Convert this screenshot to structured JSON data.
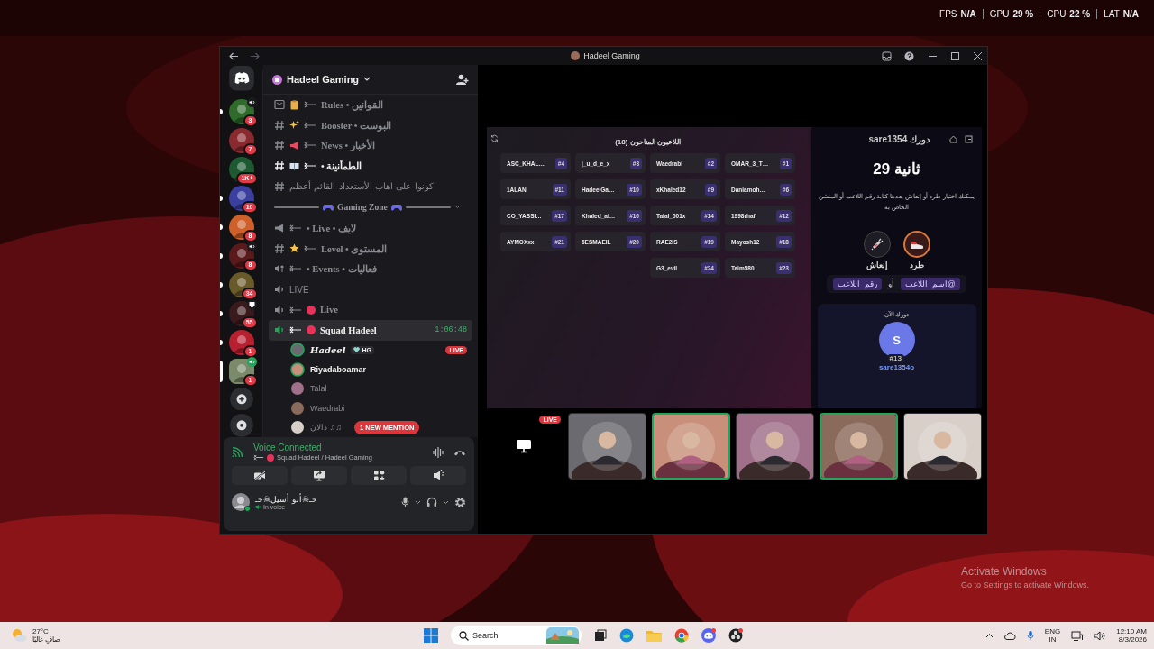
{
  "overlay": [
    {
      "label": "FPS",
      "value": "N/A"
    },
    {
      "label": "GPU",
      "value": "29 %"
    },
    {
      "label": "CPU",
      "value": "22 %"
    },
    {
      "label": "LAT",
      "value": "N/A"
    }
  ],
  "window": {
    "title": "Hadeel Gaming"
  },
  "servers": [
    {
      "badge": "3",
      "unread": true,
      "selected": false
    },
    {
      "badge": "7",
      "unread": false,
      "selected": false
    },
    {
      "badge": "1K+",
      "unread": false,
      "selected": false
    },
    {
      "badge": "10",
      "unread": true,
      "selected": false
    },
    {
      "badge": "8",
      "unread": true,
      "selected": false
    },
    {
      "badge": "8",
      "unread": true,
      "selected": false
    },
    {
      "badge": "34",
      "unread": true,
      "selected": false
    },
    {
      "badge": "55",
      "unread": true,
      "selected": false
    },
    {
      "badge": "1",
      "unread": true,
      "selected": false
    },
    {
      "badge": "1",
      "unread": false,
      "selected": true
    }
  ],
  "server_header": {
    "name": "Hadeel Gaming"
  },
  "channels": [
    {
      "kind": "rules",
      "name": "Rules • القوانين",
      "unread": false,
      "selected": false
    },
    {
      "kind": "text",
      "name": "Booster • البوست",
      "unread": false,
      "selected": false
    },
    {
      "kind": "text",
      "name": "News • الأخبار",
      "unread": false,
      "selected": false
    },
    {
      "kind": "text",
      "name": "• الطمأنينة",
      "unread": true,
      "selected": false
    },
    {
      "kind": "text",
      "name": "كونوا-على-اهاب-الأستعداد-القائم-أعظم",
      "unread": false,
      "selected": false
    },
    {
      "kind": "category",
      "name": "Gaming Zone"
    },
    {
      "kind": "announcement",
      "name": "• Live • لايف",
      "unread": false,
      "selected": false
    },
    {
      "kind": "text",
      "name": "Level • المستوى",
      "unread": false,
      "selected": false
    },
    {
      "kind": "stage",
      "name": "• Events • فعاليات",
      "unread": false,
      "selected": false
    },
    {
      "kind": "voice",
      "name": "LIVE",
      "unread": false,
      "selected": false
    },
    {
      "kind": "voice",
      "name": "Live",
      "unread": false,
      "selected": false
    },
    {
      "kind": "voice",
      "name": "Squad Hadeel",
      "unread": false,
      "selected": true,
      "time": "1:06:48",
      "members": [
        {
          "name": "Hadeel",
          "tag": "HG",
          "live": true,
          "live_label": "LIVE",
          "speaking": true
        },
        {
          "name": "Riyadaboamar",
          "live": false,
          "speaking": true
        },
        {
          "name": "Talal",
          "live": false,
          "speaking": false
        },
        {
          "name": "Waedrabi",
          "live": false,
          "speaking": false
        },
        {
          "name": "دالان ♫♫",
          "live": false,
          "speaking": false
        }
      ]
    }
  ],
  "mention": "1 NEW MENTION",
  "voice": {
    "status": "Voice Connected",
    "channel": "Squad Hadeel / Hadeel Gaming"
  },
  "user": {
    "name": "حـ☠أبو أسيل☠حـ",
    "status": "In voice"
  },
  "game": {
    "title": "اللاعبون المتاحون (18)",
    "players": [
      {
        "name": "ASC_KHAL…",
        "number": "#4"
      },
      {
        "name": "j_u_d_e_x",
        "number": "#3"
      },
      {
        "name": "Waedrabi",
        "number": "#2"
      },
      {
        "name": "OMAR_3_T…",
        "number": "#1"
      },
      {
        "name": "1ALAN",
        "number": "#11"
      },
      {
        "name": "HadeelGa…",
        "number": "#10"
      },
      {
        "name": "xKhaled12",
        "number": "#9"
      },
      {
        "name": "Daniamoh…",
        "number": "#6"
      },
      {
        "name": "CO_YASSI…",
        "number": "#17"
      },
      {
        "name": "Khaled_al…",
        "number": "#16"
      },
      {
        "name": "Talal_501x",
        "number": "#14"
      },
      {
        "name": "1998rhaf",
        "number": "#12"
      },
      {
        "name": "AYMOXxx",
        "number": "#21"
      },
      {
        "name": "6ESMAEIL",
        "number": "#20"
      },
      {
        "name": "RAE2IS",
        "number": "#19"
      },
      {
        "name": "Mayosh12",
        "number": "#18"
      },
      {
        "name": "G3_evil",
        "number": "#24"
      },
      {
        "name": "Taim580",
        "number": "#23"
      }
    ],
    "turn_header": "sare1354 دورك",
    "timer": "29 ثانية",
    "instructions": "يمكنك اختيار طرد أو إنعاش بعدها كتابة رقم اللاعب أو المنشن الخاص به",
    "actions": [
      {
        "kind": "kick",
        "label": "طرد",
        "selected": true
      },
      {
        "kind": "revive",
        "label": "إنعاش",
        "selected": false
      }
    ],
    "hints": [
      {
        "kind": "chip",
        "text": "@اسم_اللاعب"
      },
      {
        "kind": "word",
        "text": "أو"
      },
      {
        "kind": "chip",
        "text": "رقم_اللاعب"
      }
    ],
    "current": {
      "label": "دورك الآن",
      "initial": "S",
      "number": "#13",
      "name": "sare1354o"
    }
  },
  "participants": [
    {
      "kind": "stream",
      "live": true,
      "live_label": "LIVE"
    },
    {
      "kind": "picture",
      "speaking": false
    },
    {
      "kind": "picture",
      "speaking": true
    },
    {
      "kind": "picture",
      "speaking": false
    },
    {
      "kind": "picture",
      "speaking": true
    },
    {
      "kind": "picture",
      "speaking": false
    }
  ],
  "activation": {
    "title": "Activate Windows",
    "subtitle": "Go to Settings to activate Windows."
  },
  "taskbar": {
    "temp": "27°C",
    "condition": "صافٍ غالبًا",
    "search_placeholder": "Search",
    "lang": "ENG",
    "region": "IN",
    "time": "12:10 AM",
    "date": "8/3/2026"
  }
}
